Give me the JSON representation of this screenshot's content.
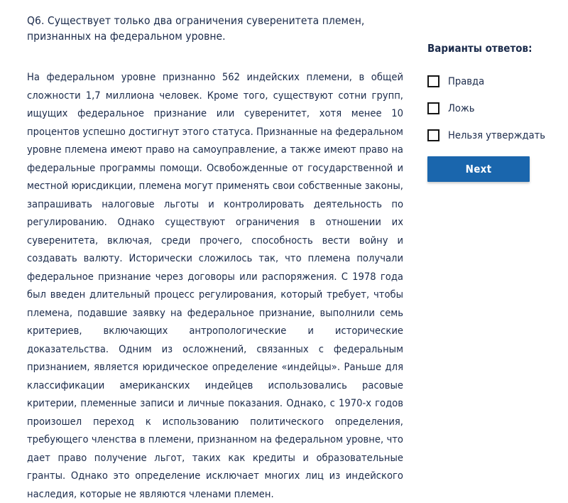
{
  "question": {
    "title": "Q6. Существует только два ограничения суверенитета племен, признанных на федеральном уровне.",
    "passage": "На федеральном уровне признанно 562 индейских племени, в общей сложности 1,7 миллиона человек. Кроме того, существуют сотни групп, ищущих федеральное признание или суверенитет, хотя менее 10 процентов успешно достигнут этого статуса. Признанные на федеральном уровне племена имеют право на самоуправление, а также имеют право на федеральные программы помощи. Освобожденные от государственной и местной юрисдикции, племена могут применять свои собственные законы, запрашивать налоговые льготы и контролировать деятельность по регулированию. Однако существуют ограничения в отношении их суверенитета, включая, среди прочего, способность вести войну и создавать валюту. Исторически сложилось так, что племена получали федеральное признание через договоры или распоряжения. С 1978 года был введен длительный процесс регулирования, который требует, чтобы племена, подавшие заявку на федеральное признание, выполнили семь критериев, включающих антропологические и исторические доказательства. Одним из осложнений, связанных с федеральным признанием, является юридическое определение «индейцы». Раньше для классификации американских индейцев использовались расовые критерии, племенные записи и личные показания. Однако, с 1970-х годов произошел переход к использованию политического определения, требующего членства в племени, признанном на федеральном уровне, что дает право получение льгот, таких как кредиты и образовательные гранты. Однако это определение исключает многих лиц из индейского наследия, которые не являются членами племен."
  },
  "answers": {
    "heading": "Варианты ответов:",
    "options": [
      {
        "label": "Правда",
        "checked": false
      },
      {
        "label": "Ложь",
        "checked": false
      },
      {
        "label": "Нельзя утверждать",
        "checked": false
      }
    ],
    "next_label": "Next"
  },
  "colors": {
    "accent": "#1a66ad",
    "text": "#1b2b4b",
    "checkbox_border": "#141414",
    "background": "#ffffff"
  }
}
